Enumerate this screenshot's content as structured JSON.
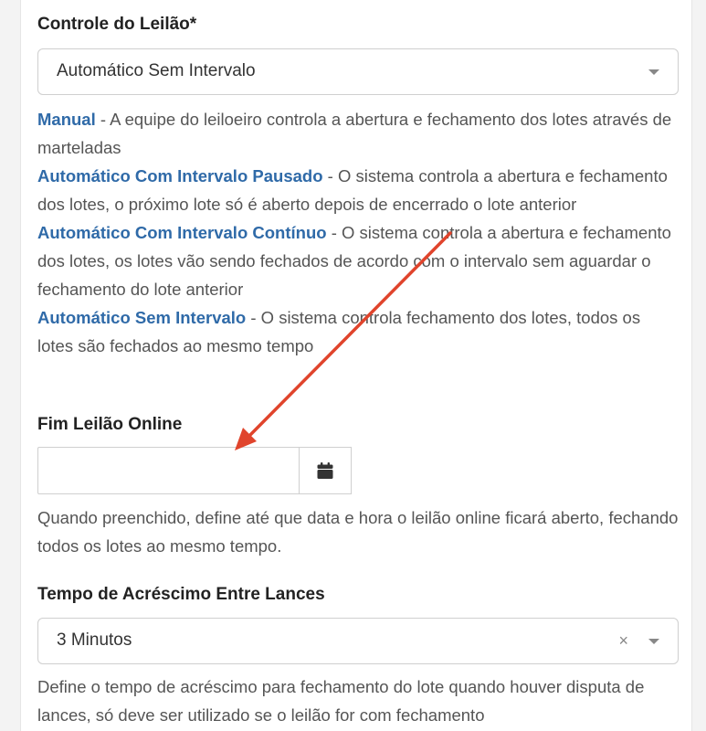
{
  "controle": {
    "label": "Controle do Leilão*",
    "selected": "Automático Sem Intervalo"
  },
  "help_controle": [
    {
      "option": "Manual",
      "desc": " - A equipe do leiloeiro controla a abertura e fechamento dos lotes através de marteladas"
    },
    {
      "option": "Automático Com Intervalo Pausado",
      "desc": " - O sistema controla a abertura e fechamento dos lotes, o próximo lote só é aberto depois de encerrado o lote anterior"
    },
    {
      "option": "Automático Com Intervalo Contínuo",
      "desc": " - O sistema controla a abertura e fechamento dos lotes, os lotes vão sendo fechados de acordo com o intervalo sem aguardar o fechamento do lote anterior"
    },
    {
      "option": "Automático Sem Intervalo",
      "desc": " - O sistema controla fechamento dos lotes, todos os lotes são fechados ao mesmo tempo"
    }
  ],
  "fim_leilao": {
    "label": "Fim Leilão Online",
    "value": "",
    "help": "Quando preenchido, define até que data e hora o leilão online ficará aberto, fechando todos os lotes ao mesmo tempo."
  },
  "tempo_acrescimo": {
    "label": "Tempo de Acréscimo Entre Lances",
    "selected": "3 Minutos",
    "clear_symbol": "×",
    "help": "Define o tempo de acréscimo para fechamento do lote quando houver disputa de lances, só deve ser utilizado se o leilão for com fechamento"
  },
  "icons": {
    "calendar": "calendar-icon",
    "caret": "chevron-down-icon",
    "clear": "clear-icon"
  },
  "colors": {
    "option_link": "#2f6aa8",
    "annotation_arrow": "#e0442c"
  }
}
